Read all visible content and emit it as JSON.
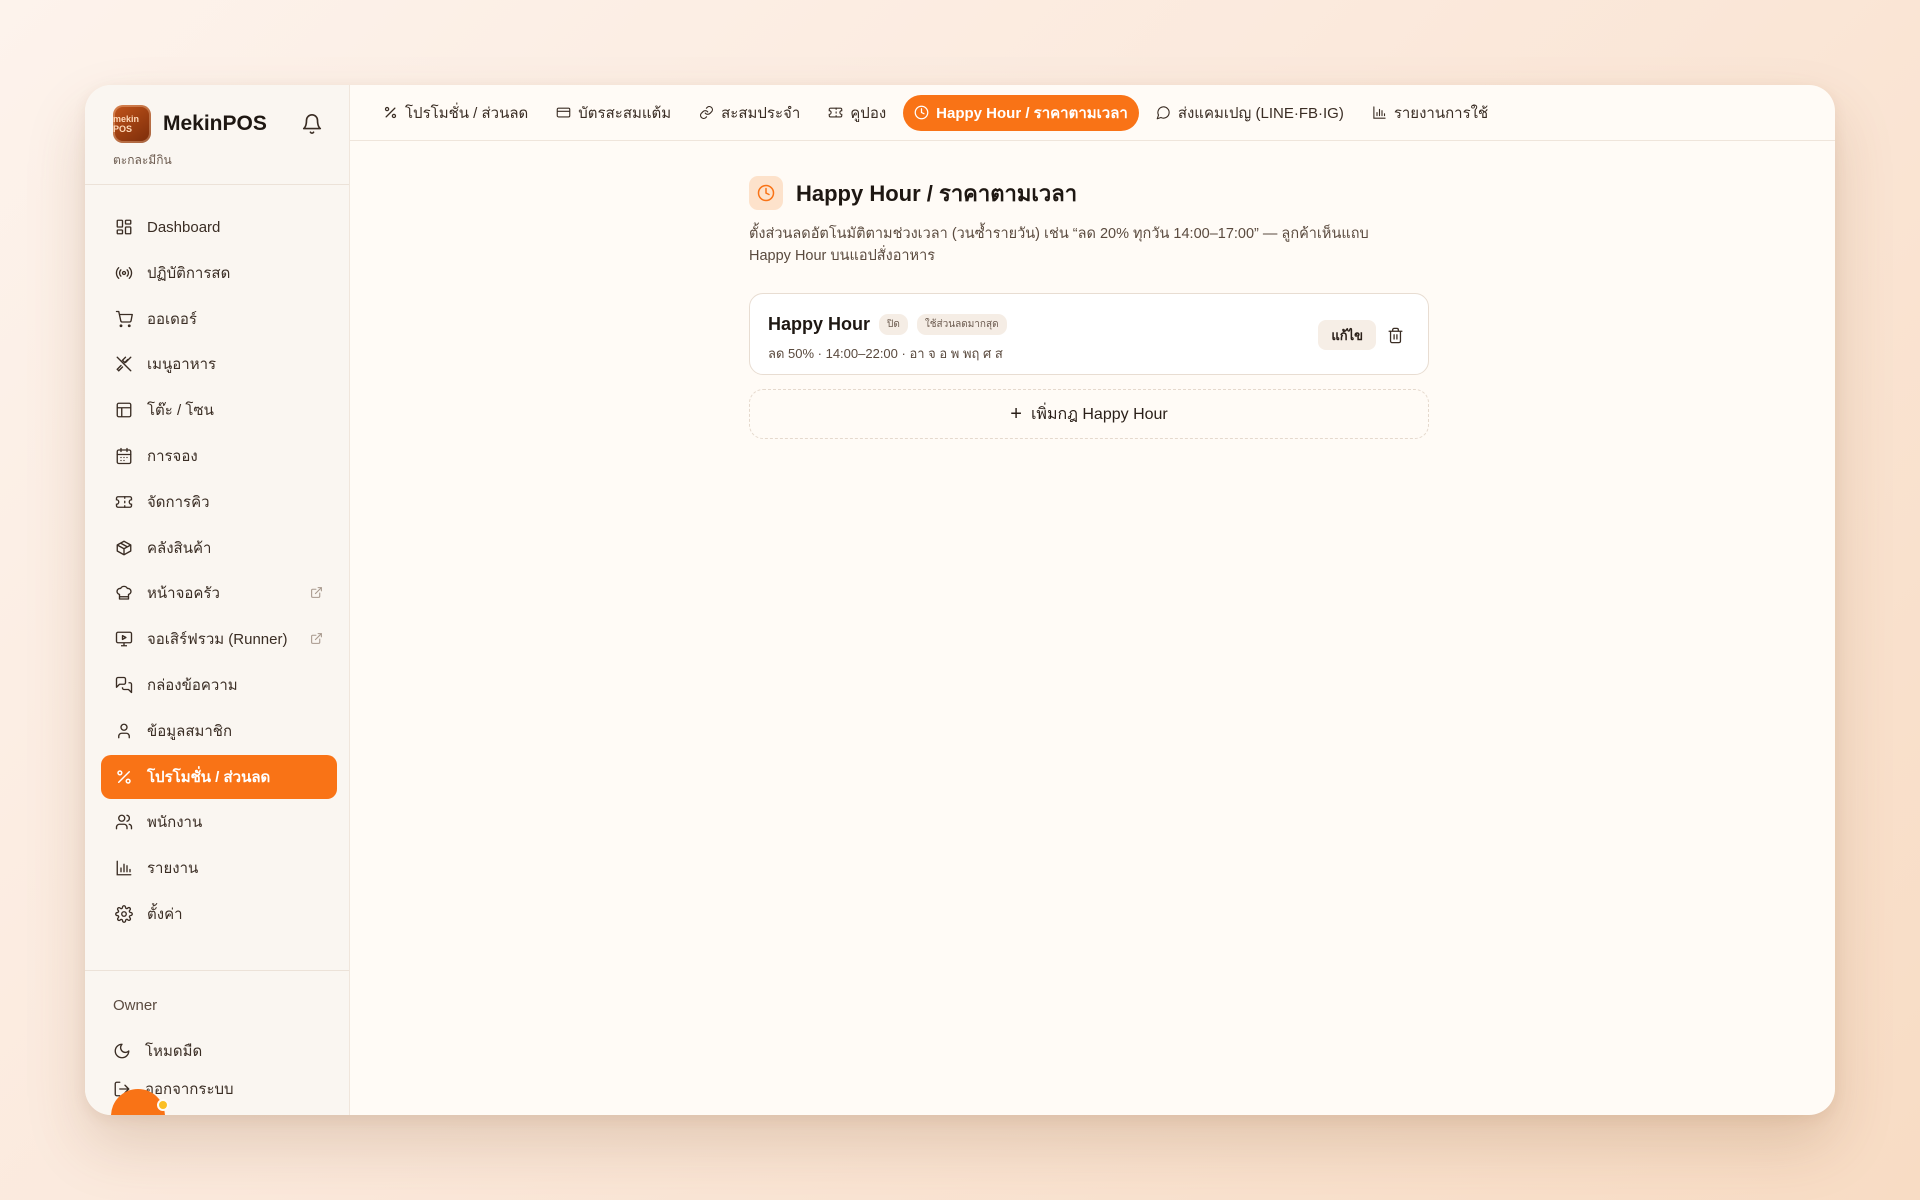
{
  "app": {
    "name": "MekinPOS",
    "subtitle": "ตะกละมีกิน",
    "logo_text": "mekin POS"
  },
  "sidebar": {
    "items": [
      {
        "label": "Dashboard",
        "icon": "dashboard-icon"
      },
      {
        "label": "ปฏิบัติการสด",
        "icon": "broadcast-icon"
      },
      {
        "label": "ออเดอร์",
        "icon": "cart-icon"
      },
      {
        "label": "เมนูอาหาร",
        "icon": "utensils-icon"
      },
      {
        "label": "โต๊ะ / โซน",
        "icon": "table-icon"
      },
      {
        "label": "การจอง",
        "icon": "calendar-icon"
      },
      {
        "label": "จัดการคิว",
        "icon": "ticket-icon"
      },
      {
        "label": "คลังสินค้า",
        "icon": "package-icon"
      },
      {
        "label": "หน้าจอครัว",
        "icon": "chef-hat-icon",
        "external": true
      },
      {
        "label": "จอเสิร์ฟรวม (Runner)",
        "icon": "monitor-play-icon",
        "external": true
      },
      {
        "label": "กล่องข้อความ",
        "icon": "messages-icon"
      },
      {
        "label": "ข้อมูลสมาชิก",
        "icon": "user-icon"
      },
      {
        "label": "โปรโมชั่น / ส่วนลด",
        "icon": "percent-icon",
        "active": true
      },
      {
        "label": "พนักงาน",
        "icon": "users-icon"
      },
      {
        "label": "รายงาน",
        "icon": "bar-chart-icon"
      },
      {
        "label": "ตั้งค่า",
        "icon": "gear-icon"
      }
    ],
    "owner_label": "Owner",
    "dark_mode_label": "โหมดมืด",
    "logout_label": "ออกจากระบบ"
  },
  "tabs": [
    {
      "label": "โปรโมชั่น / ส่วนลด",
      "icon": "percent-icon"
    },
    {
      "label": "บัตรสะสมแต้ม",
      "icon": "card-icon"
    },
    {
      "label": "สะสมประจำ",
      "icon": "link-icon"
    },
    {
      "label": "คูปอง",
      "icon": "ticket-icon"
    },
    {
      "label": "Happy Hour / ราคาตามเวลา",
      "icon": "clock-icon",
      "active": true
    },
    {
      "label": "ส่งแคมเปญ (LINE·FB·IG)",
      "icon": "chat-icon"
    },
    {
      "label": "รายงานการใช้",
      "icon": "bar-chart-icon"
    }
  ],
  "page": {
    "title": "Happy Hour / ราคาตามเวลา",
    "description": "ตั้งส่วนลดอัตโนมัติตามช่วงเวลา (วนซ้ำรายวัน) เช่น “ลด 20% ทุกวัน 14:00–17:00” — ลูกค้าเห็นแถบ Happy Hour บนแอปสั่งอาหาร"
  },
  "rules": [
    {
      "name": "Happy Hour",
      "status_badge": "ปิด",
      "mode_badge": "ใช้ส่วนลดมากสุด",
      "meta": "ลด 50% · 14:00–22:00 · อา จ อ พ พฤ ศ ส",
      "edit_label": "แก้ไข"
    }
  ],
  "add_rule_label": "เพิ่มกฎ Happy Hour",
  "colors": {
    "accent": "#f97316",
    "background": "#fffbf6",
    "sidebar": "#faf6f1"
  }
}
